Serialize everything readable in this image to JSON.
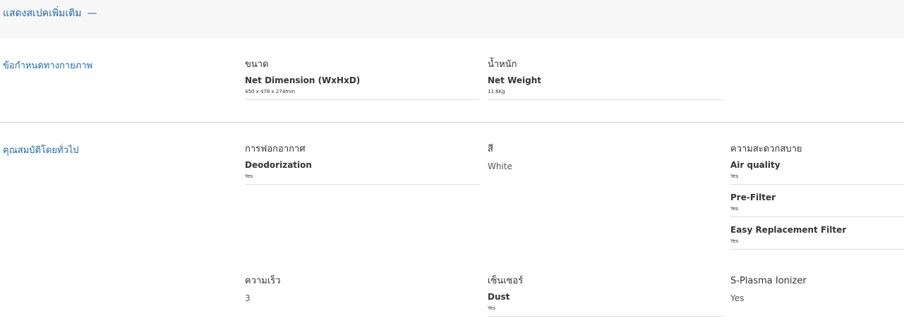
{
  "toggle": {
    "label": "แสดงสเปคเพิ่มเติม",
    "icon": "—"
  },
  "sections": {
    "physical": {
      "title": "ข้อกำหนดทางกายภาพ",
      "size": {
        "category": "ขนาด",
        "item_label": "Net Dimension (WxHxD)",
        "item_value": "450 x 478 x 274mm"
      },
      "weight": {
        "category": "น้ำหนัก",
        "item_label": "Net Weight",
        "item_value": "11.6Kg"
      }
    },
    "general": {
      "title": "คุณสมบัติโดยทั่วไป",
      "purification": {
        "category": "การฟอกอากาศ",
        "item_label": "Deodorization",
        "item_value": "Yes"
      },
      "color": {
        "category": "สี",
        "value": "White"
      },
      "convenience": {
        "category": "ความสะดวกสบาย",
        "items": [
          {
            "label": "Air quality",
            "value": "Yes"
          },
          {
            "label": "Pre-Filter",
            "value": "Yes"
          },
          {
            "label": "Easy Replacement Filter",
            "value": "Yes"
          }
        ]
      },
      "speed": {
        "category": "ความเร็ว",
        "value": "3"
      },
      "sensor": {
        "category": "เซ็นเซอร์",
        "item_label": "Dust",
        "item_value": "Yes"
      },
      "ionizer": {
        "category": "S-Plasma Ionizer",
        "value": "Yes"
      }
    }
  },
  "colors": {
    "accent": "#1a6ab3",
    "topbar_bg": "#f7f7f7",
    "divider": "#cccccc"
  }
}
